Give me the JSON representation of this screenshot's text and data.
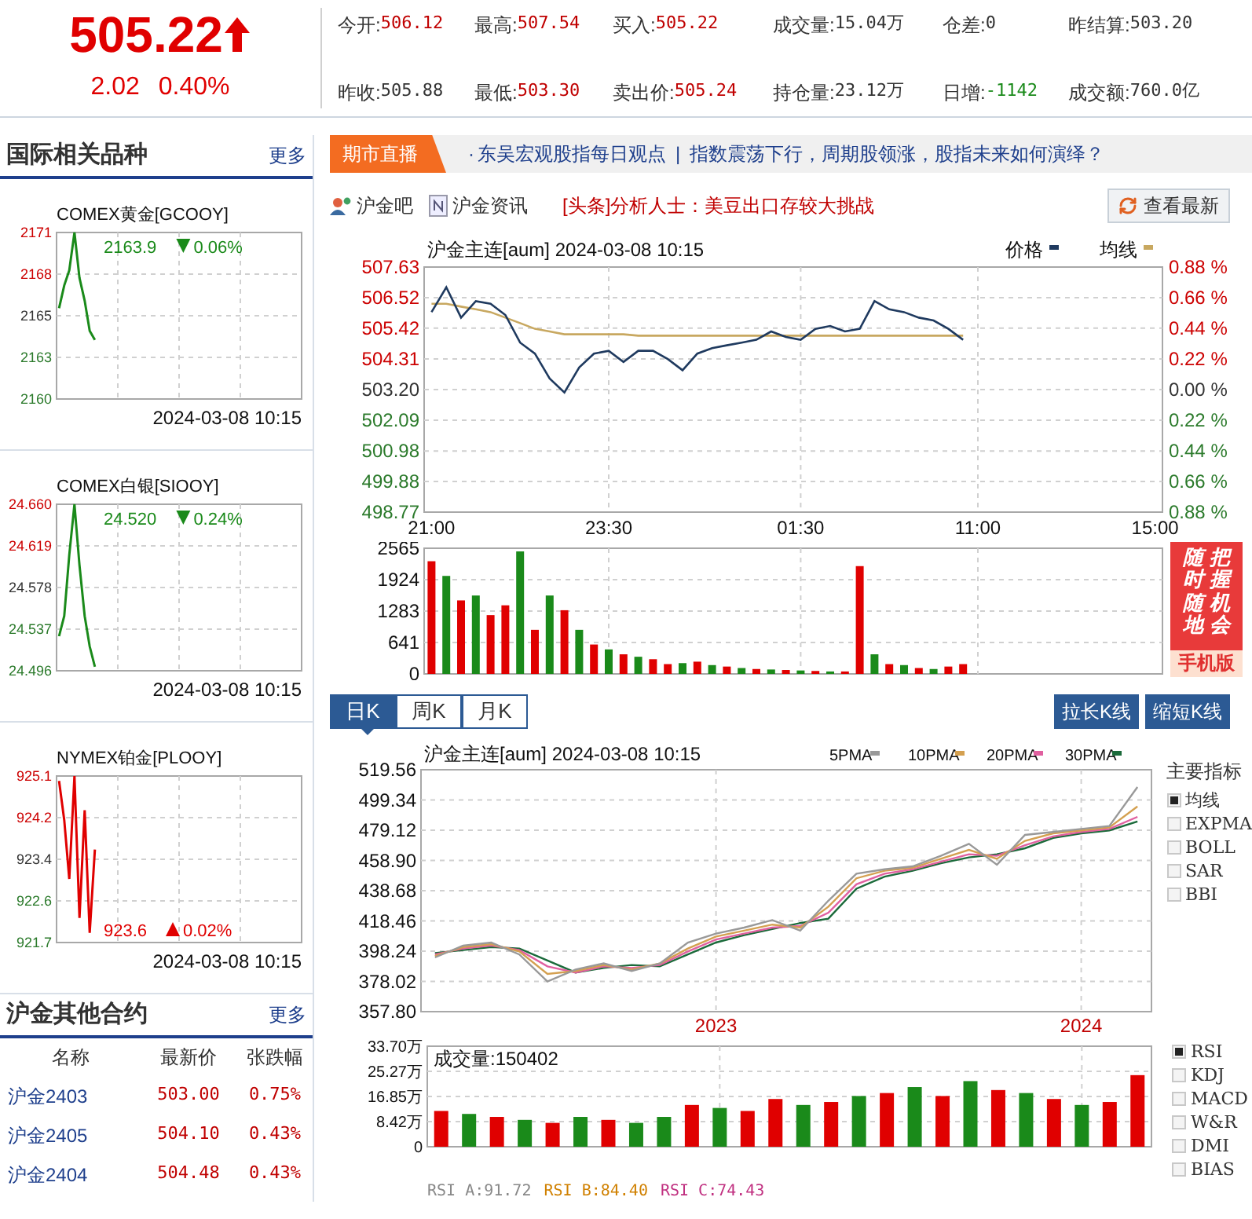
{
  "quote": {
    "price": "505.22",
    "rising": true,
    "change": "2.02",
    "change_pct": "0.40%"
  },
  "stats": [
    {
      "label": "今开:",
      "value": "506.12",
      "color": "#c00000"
    },
    {
      "label": "最高:",
      "value": "507.54",
      "color": "#c00000"
    },
    {
      "label": "买入:",
      "value": "505.22",
      "color": "#c00000"
    },
    {
      "label": "成交量:",
      "value": "15.04万",
      "color": "#333333"
    },
    {
      "label": "仓差:",
      "value": "0",
      "color": "#333333"
    },
    {
      "label": "昨结算:",
      "value": "503.20",
      "color": "#333333"
    },
    {
      "label": "昨收:",
      "value": "505.88",
      "color": "#333333"
    },
    {
      "label": "最低:",
      "value": "503.30",
      "color": "#c00000"
    },
    {
      "label": "卖出价:",
      "value": "505.24",
      "color": "#c00000"
    },
    {
      "label": "持仓量:",
      "value": "23.12万",
      "color": "#333333"
    },
    {
      "label": "日增:",
      "value": "-1142",
      "color": "#1a8a1a"
    },
    {
      "label": "成交额:",
      "value": "760.0亿",
      "color": "#333333"
    }
  ],
  "related": {
    "title": "国际相关品种",
    "more": "更多",
    "items": [
      {
        "name": "COMEX黄金[GCOOY]",
        "reading": "2163.9",
        "change": "0.06%",
        "rising": false,
        "reading_below": false,
        "time": "2024-03-08 10:15",
        "chart_data": {
          "type": "line",
          "grid": true,
          "categories": [
            null,
            null,
            null,
            null,
            null,
            null,
            null,
            null,
            null,
            null,
            null,
            null,
            null,
            null,
            null,
            null,
            null,
            null,
            null,
            null,
            null,
            null,
            null,
            null,
            null,
            null,
            null,
            null,
            null,
            null,
            null,
            null,
            null,
            null,
            null,
            null,
            null,
            null,
            null,
            null,
            null,
            null,
            null,
            null,
            null,
            null,
            null,
            null
          ],
          "ylim": [
            2160,
            2171
          ],
          "yticks": [
            {
              "value": 2160,
              "label": "2160"
            },
            {
              "value": 2162.75,
              "label": "2163"
            },
            {
              "value": 2165.5,
              "label": "2165"
            },
            {
              "value": 2168.25,
              "label": "2168"
            },
            {
              "value": 2171,
              "label": "2171"
            }
          ],
          "series": [
            {
              "color": "#1a8a1a",
              "values": [
                2166,
                2167.5,
                2168.5,
                2171,
                2168,
                2166.5,
                2164.5,
                2163.9,
                null,
                null,
                null,
                null,
                null,
                null,
                null,
                null,
                null,
                null,
                null,
                null,
                null,
                null,
                null,
                null,
                null,
                null,
                null,
                null,
                null,
                null,
                null,
                null,
                null,
                null,
                null,
                null,
                null,
                null,
                null,
                null,
                null,
                null,
                null,
                null,
                null,
                null,
                null,
                null
              ]
            }
          ]
        }
      },
      {
        "name": "COMEX白银[SIOOY]",
        "reading": "24.520",
        "change": "0.24%",
        "rising": false,
        "reading_below": false,
        "time": "2024-03-08 10:15",
        "chart_data": {
          "type": "line",
          "grid": true,
          "categories": [
            null,
            null,
            null,
            null,
            null,
            null,
            null,
            null,
            null,
            null,
            null,
            null,
            null,
            null,
            null,
            null,
            null,
            null,
            null,
            null,
            null,
            null,
            null,
            null,
            null,
            null,
            null,
            null,
            null,
            null,
            null,
            null,
            null,
            null,
            null,
            null,
            null,
            null,
            null,
            null,
            null,
            null,
            null,
            null,
            null,
            null,
            null,
            null
          ],
          "ylim": [
            24.496,
            24.66
          ],
          "yticks": [
            {
              "value": 24.496,
              "label": "24.496"
            },
            {
              "value": 24.537,
              "label": "24.537"
            },
            {
              "value": 24.578,
              "label": "24.578"
            },
            {
              "value": 24.619,
              "label": "24.619"
            },
            {
              "value": 24.66,
              "label": "24.660"
            }
          ],
          "series": [
            {
              "color": "#1a8a1a",
              "values": [
                24.53,
                24.55,
                24.61,
                24.66,
                24.6,
                24.55,
                24.52,
                24.5,
                null,
                null,
                null,
                null,
                null,
                null,
                null,
                null,
                null,
                null,
                null,
                null,
                null,
                null,
                null,
                null,
                null,
                null,
                null,
                null,
                null,
                null,
                null,
                null,
                null,
                null,
                null,
                null,
                null,
                null,
                null,
                null,
                null,
                null,
                null,
                null,
                null,
                null,
                null,
                null
              ]
            }
          ]
        }
      },
      {
        "name": "NYMEX铂金[PLOOY]",
        "reading": "923.6",
        "change": "0.02%",
        "rising": true,
        "reading_below": true,
        "time": "2024-03-08 10:15",
        "chart_data": {
          "type": "line",
          "grid": true,
          "categories": [
            null,
            null,
            null,
            null,
            null,
            null,
            null,
            null,
            null,
            null,
            null,
            null,
            null,
            null,
            null,
            null,
            null,
            null,
            null,
            null,
            null,
            null,
            null,
            null,
            null,
            null,
            null,
            null,
            null,
            null,
            null,
            null,
            null,
            null,
            null,
            null,
            null,
            null,
            null,
            null,
            null,
            null,
            null,
            null,
            null,
            null,
            null,
            null
          ],
          "ylim": [
            921.7,
            925.1
          ],
          "yticks": [
            {
              "value": 921.7,
              "label": "921.7"
            },
            {
              "value": 922.55,
              "label": "922.6"
            },
            {
              "value": 923.4,
              "label": "923.4"
            },
            {
              "value": 924.25,
              "label": "924.2"
            },
            {
              "value": 925.1,
              "label": "925.1"
            }
          ],
          "series": [
            {
              "color": "#e00000",
              "values": [
                925,
                924.2,
                923,
                925.1,
                922.2,
                924.4,
                921.9,
                923.6,
                null,
                null,
                null,
                null,
                null,
                null,
                null,
                null,
                null,
                null,
                null,
                null,
                null,
                null,
                null,
                null,
                null,
                null,
                null,
                null,
                null,
                null,
                null,
                null,
                null,
                null,
                null,
                null,
                null,
                null,
                null,
                null,
                null,
                null,
                null,
                null,
                null,
                null,
                null,
                null
              ]
            }
          ]
        }
      }
    ]
  },
  "contracts": {
    "title": "沪金其他合约",
    "more": "更多",
    "columns": [
      "名称",
      "最新价",
      "张跌幅"
    ],
    "rows": [
      {
        "name": "沪金2403",
        "price": "503.00",
        "change": "0.75%"
      },
      {
        "name": "沪金2405",
        "price": "504.10",
        "change": "0.43%"
      },
      {
        "name": "沪金2404",
        "price": "504.48",
        "change": "0.43%"
      }
    ]
  },
  "live": {
    "label": "期市直播",
    "bullet": "·",
    "headlines": [
      "东吴宏观股指每日观点",
      "指数震荡下行，周期股领涨，股指未来如何演绎？"
    ],
    "separator": "|"
  },
  "links": [
    {
      "label": "沪金吧",
      "kind": "forum"
    },
    {
      "label": "沪金资讯",
      "kind": "news"
    }
  ],
  "top_news": "[头条]分析人士：美豆出口存较大挑战",
  "refresh_button": "查看最新",
  "intraday": {
    "title": "沪金主连[aum] 2024-03-08 10:15",
    "right_axis_labels": [
      "0.88 %",
      "0.66 %",
      "0.44 %",
      "0.22 %",
      "0.00 %",
      "0.22 %",
      "0.44 %",
      "0.66 %",
      "0.88 %"
    ],
    "chart_data": {
      "type": "line",
      "grid": true,
      "legend": "top-right",
      "categories": [
        "21:00",
        null,
        null,
        null,
        null,
        null,
        null,
        null,
        null,
        null,
        null,
        null,
        "23:30",
        null,
        null,
        null,
        null,
        null,
        null,
        null,
        null,
        null,
        null,
        null,
        null,
        "01:30",
        null,
        null,
        null,
        null,
        null,
        null,
        null,
        null,
        null,
        null,
        null,
        "11:00",
        null,
        null,
        null,
        null,
        null,
        null,
        null,
        null,
        null,
        null,
        null,
        "15:00"
      ],
      "ylim": [
        498.77,
        507.63
      ],
      "yticks": [
        {
          "value": 498.77,
          "label": "498.77"
        },
        {
          "value": 499.88,
          "label": "499.88"
        },
        {
          "value": 500.98,
          "label": "500.98"
        },
        {
          "value": 502.09,
          "label": "502.09"
        },
        {
          "value": 503.2,
          "label": "503.20"
        },
        {
          "value": 504.31,
          "label": "504.31"
        },
        {
          "value": 505.42,
          "label": "505.42"
        },
        {
          "value": 506.52,
          "label": "506.52"
        },
        {
          "value": 507.63,
          "label": "507.63"
        }
      ],
      "series": [
        {
          "name": "价格",
          "color": "#1f3a5f",
          "values": [
            506.0,
            506.9,
            505.8,
            506.4,
            506.3,
            505.9,
            504.9,
            504.5,
            503.6,
            503.1,
            504.0,
            504.5,
            504.6,
            504.2,
            504.6,
            504.6,
            504.3,
            503.9,
            504.5,
            504.7,
            504.8,
            504.9,
            505.0,
            505.3,
            505.1,
            505.0,
            505.4,
            505.5,
            505.3,
            505.4,
            506.4,
            506.1,
            506.0,
            505.8,
            505.7,
            505.4,
            505.0,
            null,
            null,
            null,
            null,
            null,
            null,
            null,
            null,
            null,
            null,
            null,
            null,
            null
          ]
        },
        {
          "name": "均线",
          "color": "#c8a860",
          "values": [
            506.3,
            506.3,
            506.2,
            506.1,
            506.0,
            505.8,
            505.6,
            505.4,
            505.3,
            505.2,
            505.2,
            505.2,
            505.2,
            505.2,
            505.15,
            505.15,
            505.15,
            505.15,
            505.15,
            505.15,
            505.15,
            505.15,
            505.15,
            505.15,
            505.15,
            505.15,
            505.15,
            505.15,
            505.15,
            505.15,
            505.15,
            505.15,
            505.15,
            505.15,
            505.15,
            505.15,
            505.15,
            null,
            null,
            null,
            null,
            null,
            null,
            null,
            null,
            null,
            null,
            null,
            null,
            null
          ]
        }
      ]
    }
  },
  "intraday_volume": {
    "chart_data": {
      "type": "bar",
      "stacked": true,
      "grid": true,
      "categories": [
        null,
        null,
        null,
        null,
        null,
        null,
        null,
        null,
        null,
        null,
        null,
        null,
        null,
        null,
        null,
        null,
        null,
        null,
        null,
        null,
        null,
        null,
        null,
        null,
        null,
        null,
        null,
        null,
        null,
        null,
        null,
        null,
        null,
        null,
        null,
        null,
        null,
        null,
        null,
        null,
        null,
        null,
        null,
        null,
        null,
        null,
        null,
        null,
        null,
        null
      ],
      "ylim": [
        0,
        2565
      ],
      "yticks": [
        {
          "value": 0,
          "label": "0"
        },
        {
          "value": 641,
          "label": "641"
        },
        {
          "value": 1283,
          "label": "1283"
        },
        {
          "value": 1924,
          "label": "1924"
        },
        {
          "value": 2565,
          "label": "2565"
        }
      ],
      "series": [
        {
          "color": "#e00000",
          "values": [
            2300,
            null,
            1500,
            null,
            1200,
            1400,
            null,
            900,
            null,
            1300,
            null,
            600,
            null,
            400,
            null,
            300,
            200,
            null,
            250,
            null,
            150,
            null,
            100,
            null,
            80,
            null,
            60,
            null,
            50,
            2200,
            null,
            200,
            null,
            120,
            null,
            150,
            200,
            null,
            null,
            null,
            null,
            null,
            null,
            null,
            null,
            null,
            null,
            null,
            null,
            null
          ]
        },
        {
          "color": "#1a8a1a",
          "values": [
            null,
            2000,
            null,
            1600,
            null,
            null,
            2500,
            null,
            1600,
            null,
            900,
            null,
            500,
            null,
            350,
            null,
            null,
            220,
            null,
            180,
            null,
            120,
            null,
            90,
            null,
            70,
            null,
            50,
            null,
            null,
            400,
            null,
            180,
            null,
            100,
            null,
            null,
            null,
            null,
            null,
            null,
            null,
            null,
            null,
            null,
            null,
            null,
            null,
            null,
            null
          ]
        }
      ]
    }
  },
  "promo": {
    "columns": [
      "随时随地",
      "把握机会"
    ],
    "footer": "手机版"
  },
  "period_tabs": [
    {
      "label": "日K",
      "selected": true
    },
    {
      "label": "周K",
      "selected": false
    },
    {
      "label": "月K",
      "selected": false
    }
  ],
  "zoom_buttons": [
    "拉长K线",
    "缩短K线"
  ],
  "kline": {
    "title": "沪金主连[aum] 2024-03-08 10:15",
    "chart_data": {
      "type": "line",
      "grid": true,
      "legend": "top-right",
      "categories": [
        null,
        null,
        null,
        null,
        null,
        null,
        null,
        null,
        null,
        null,
        "2023",
        null,
        null,
        null,
        null,
        null,
        null,
        null,
        null,
        null,
        null,
        null,
        null,
        "2024",
        null,
        null
      ],
      "ylim": [
        357.8,
        519.56
      ],
      "yticks": [
        {
          "value": 357.8,
          "label": "357.80"
        },
        {
          "value": 378.02,
          "label": "378.02"
        },
        {
          "value": 398.24,
          "label": "398.24"
        },
        {
          "value": 418.46,
          "label": "418.46"
        },
        {
          "value": 438.68,
          "label": "438.68"
        },
        {
          "value": 458.9,
          "label": "458.90"
        },
        {
          "value": 479.12,
          "label": "479.12"
        },
        {
          "value": 499.34,
          "label": "499.34"
        },
        {
          "value": 519.56,
          "label": "519.56"
        }
      ],
      "series": [
        {
          "name": "5PMA",
          "color": "#999999",
          "values": [
            394,
            402,
            404,
            396,
            378,
            386,
            390,
            385,
            390,
            404,
            410,
            414,
            419,
            412,
            432,
            450,
            453,
            455,
            462,
            470,
            456,
            476,
            478,
            480,
            482,
            508
          ]
        },
        {
          "name": "10PMA",
          "color": "#d4a050",
          "values": [
            395,
            401,
            403,
            398,
            383,
            385,
            389,
            386,
            390,
            400,
            408,
            412,
            416,
            414,
            428,
            447,
            452,
            454,
            460,
            466,
            460,
            472,
            477,
            479,
            481,
            495
          ]
        },
        {
          "name": "20PMA",
          "color": "#e060a0",
          "values": [
            396,
            400,
            402,
            399,
            388,
            384,
            388,
            387,
            389,
            398,
            406,
            410,
            414,
            415,
            424,
            443,
            450,
            453,
            458,
            463,
            462,
            469,
            475,
            478,
            480,
            488
          ]
        },
        {
          "name": "30PMA",
          "color": "#1a6a3a",
          "values": [
            397,
            399,
            401,
            400,
            392,
            384,
            387,
            389,
            388,
            396,
            404,
            409,
            413,
            417,
            420,
            440,
            448,
            452,
            457,
            461,
            463,
            467,
            474,
            477,
            479,
            485
          ]
        }
      ]
    }
  },
  "main_indicators": {
    "title": "主要指标",
    "items": [
      {
        "label": "均线",
        "checked": true
      },
      {
        "label": "EXPMA",
        "checked": false
      },
      {
        "label": "BOLL",
        "checked": false
      },
      {
        "label": "SAR",
        "checked": false
      },
      {
        "label": "BBI",
        "checked": false
      }
    ]
  },
  "kline_volume": {
    "title": "成交量:150402",
    "chart_data": {
      "type": "bar",
      "stacked": true,
      "grid": true,
      "categories": [
        null,
        null,
        null,
        null,
        null,
        null,
        null,
        null,
        null,
        null,
        null,
        null,
        null,
        null,
        null,
        null,
        null,
        null,
        null,
        null,
        null,
        null,
        null,
        null,
        null,
        null
      ],
      "ylim": [
        0,
        33.7
      ],
      "yticks": [
        {
          "value": 0,
          "label": "0"
        },
        {
          "value": 8.42,
          "label": "8.42万"
        },
        {
          "value": 16.85,
          "label": "16.85万"
        },
        {
          "value": 25.27,
          "label": "25.27万"
        },
        {
          "value": 33.7,
          "label": "33.70万"
        }
      ],
      "series": [
        {
          "color": "#e00000",
          "values": [
            12,
            null,
            10,
            null,
            8,
            null,
            9,
            null,
            null,
            14,
            null,
            12,
            16,
            null,
            15,
            null,
            18,
            null,
            17,
            null,
            19,
            null,
            16,
            null,
            15,
            24
          ]
        },
        {
          "color": "#1a8a1a",
          "values": [
            null,
            11,
            null,
            9,
            null,
            10,
            null,
            8,
            10,
            null,
            13,
            null,
            null,
            14,
            null,
            17,
            null,
            20,
            null,
            22,
            null,
            18,
            null,
            14,
            null,
            null
          ]
        }
      ]
    }
  },
  "sub_indicators": {
    "items": [
      {
        "label": "RSI",
        "checked": true
      },
      {
        "label": "KDJ",
        "checked": false
      },
      {
        "label": "MACD",
        "checked": false
      },
      {
        "label": "W&R",
        "checked": false
      },
      {
        "label": "DMI",
        "checked": false
      },
      {
        "label": "BIAS",
        "checked": false
      }
    ]
  },
  "rsi_legend": [
    {
      "label": "RSI A:91.72",
      "color": "#888888"
    },
    {
      "label": "RSI B:84.40",
      "color": "#d08000"
    },
    {
      "label": "RSI C:74.43",
      "color": "#c03080"
    }
  ]
}
